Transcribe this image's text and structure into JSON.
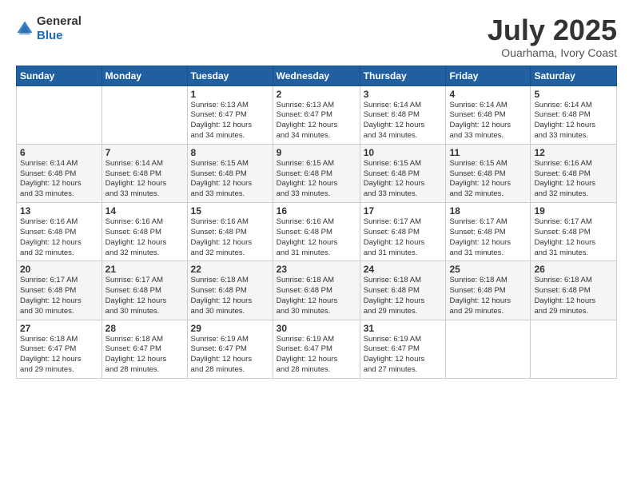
{
  "header": {
    "logo_general": "General",
    "logo_blue": "Blue",
    "title": "July 2025",
    "subtitle": "Ouarhama, Ivory Coast"
  },
  "columns": [
    "Sunday",
    "Monday",
    "Tuesday",
    "Wednesday",
    "Thursday",
    "Friday",
    "Saturday"
  ],
  "weeks": [
    [
      {
        "day": "",
        "info": ""
      },
      {
        "day": "",
        "info": ""
      },
      {
        "day": "1",
        "info": "Sunrise: 6:13 AM\nSunset: 6:47 PM\nDaylight: 12 hours\nand 34 minutes."
      },
      {
        "day": "2",
        "info": "Sunrise: 6:13 AM\nSunset: 6:47 PM\nDaylight: 12 hours\nand 34 minutes."
      },
      {
        "day": "3",
        "info": "Sunrise: 6:14 AM\nSunset: 6:48 PM\nDaylight: 12 hours\nand 34 minutes."
      },
      {
        "day": "4",
        "info": "Sunrise: 6:14 AM\nSunset: 6:48 PM\nDaylight: 12 hours\nand 33 minutes."
      },
      {
        "day": "5",
        "info": "Sunrise: 6:14 AM\nSunset: 6:48 PM\nDaylight: 12 hours\nand 33 minutes."
      }
    ],
    [
      {
        "day": "6",
        "info": "Sunrise: 6:14 AM\nSunset: 6:48 PM\nDaylight: 12 hours\nand 33 minutes."
      },
      {
        "day": "7",
        "info": "Sunrise: 6:14 AM\nSunset: 6:48 PM\nDaylight: 12 hours\nand 33 minutes."
      },
      {
        "day": "8",
        "info": "Sunrise: 6:15 AM\nSunset: 6:48 PM\nDaylight: 12 hours\nand 33 minutes."
      },
      {
        "day": "9",
        "info": "Sunrise: 6:15 AM\nSunset: 6:48 PM\nDaylight: 12 hours\nand 33 minutes."
      },
      {
        "day": "10",
        "info": "Sunrise: 6:15 AM\nSunset: 6:48 PM\nDaylight: 12 hours\nand 33 minutes."
      },
      {
        "day": "11",
        "info": "Sunrise: 6:15 AM\nSunset: 6:48 PM\nDaylight: 12 hours\nand 32 minutes."
      },
      {
        "day": "12",
        "info": "Sunrise: 6:16 AM\nSunset: 6:48 PM\nDaylight: 12 hours\nand 32 minutes."
      }
    ],
    [
      {
        "day": "13",
        "info": "Sunrise: 6:16 AM\nSunset: 6:48 PM\nDaylight: 12 hours\nand 32 minutes."
      },
      {
        "day": "14",
        "info": "Sunrise: 6:16 AM\nSunset: 6:48 PM\nDaylight: 12 hours\nand 32 minutes."
      },
      {
        "day": "15",
        "info": "Sunrise: 6:16 AM\nSunset: 6:48 PM\nDaylight: 12 hours\nand 32 minutes."
      },
      {
        "day": "16",
        "info": "Sunrise: 6:16 AM\nSunset: 6:48 PM\nDaylight: 12 hours\nand 31 minutes."
      },
      {
        "day": "17",
        "info": "Sunrise: 6:17 AM\nSunset: 6:48 PM\nDaylight: 12 hours\nand 31 minutes."
      },
      {
        "day": "18",
        "info": "Sunrise: 6:17 AM\nSunset: 6:48 PM\nDaylight: 12 hours\nand 31 minutes."
      },
      {
        "day": "19",
        "info": "Sunrise: 6:17 AM\nSunset: 6:48 PM\nDaylight: 12 hours\nand 31 minutes."
      }
    ],
    [
      {
        "day": "20",
        "info": "Sunrise: 6:17 AM\nSunset: 6:48 PM\nDaylight: 12 hours\nand 30 minutes."
      },
      {
        "day": "21",
        "info": "Sunrise: 6:17 AM\nSunset: 6:48 PM\nDaylight: 12 hours\nand 30 minutes."
      },
      {
        "day": "22",
        "info": "Sunrise: 6:18 AM\nSunset: 6:48 PM\nDaylight: 12 hours\nand 30 minutes."
      },
      {
        "day": "23",
        "info": "Sunrise: 6:18 AM\nSunset: 6:48 PM\nDaylight: 12 hours\nand 30 minutes."
      },
      {
        "day": "24",
        "info": "Sunrise: 6:18 AM\nSunset: 6:48 PM\nDaylight: 12 hours\nand 29 minutes."
      },
      {
        "day": "25",
        "info": "Sunrise: 6:18 AM\nSunset: 6:48 PM\nDaylight: 12 hours\nand 29 minutes."
      },
      {
        "day": "26",
        "info": "Sunrise: 6:18 AM\nSunset: 6:48 PM\nDaylight: 12 hours\nand 29 minutes."
      }
    ],
    [
      {
        "day": "27",
        "info": "Sunrise: 6:18 AM\nSunset: 6:47 PM\nDaylight: 12 hours\nand 29 minutes."
      },
      {
        "day": "28",
        "info": "Sunrise: 6:18 AM\nSunset: 6:47 PM\nDaylight: 12 hours\nand 28 minutes."
      },
      {
        "day": "29",
        "info": "Sunrise: 6:19 AM\nSunset: 6:47 PM\nDaylight: 12 hours\nand 28 minutes."
      },
      {
        "day": "30",
        "info": "Sunrise: 6:19 AM\nSunset: 6:47 PM\nDaylight: 12 hours\nand 28 minutes."
      },
      {
        "day": "31",
        "info": "Sunrise: 6:19 AM\nSunset: 6:47 PM\nDaylight: 12 hours\nand 27 minutes."
      },
      {
        "day": "",
        "info": ""
      },
      {
        "day": "",
        "info": ""
      }
    ]
  ]
}
